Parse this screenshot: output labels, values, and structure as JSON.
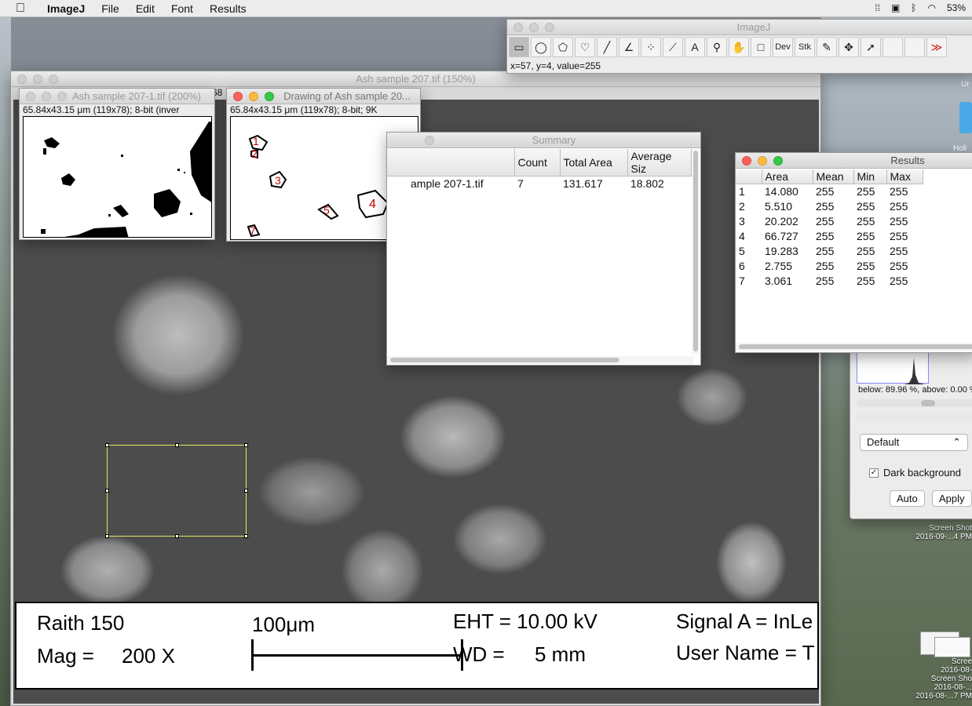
{
  "menubar": {
    "app": "ImageJ",
    "items": [
      "File",
      "Edit",
      "Font",
      "Results"
    ],
    "battery": "53%"
  },
  "toolbar_window": {
    "title": "ImageJ",
    "status": "x=57, y=4, value=255",
    "tools": [
      {
        "icon": "rectangle-icon",
        "glyph": "▭"
      },
      {
        "icon": "oval-icon",
        "glyph": "◯"
      },
      {
        "icon": "polygon-icon",
        "glyph": "⬠"
      },
      {
        "icon": "freehand-icon",
        "glyph": "♡"
      },
      {
        "icon": "line-icon",
        "glyph": "╱"
      },
      {
        "icon": "angle-icon",
        "glyph": "∠"
      },
      {
        "icon": "point-icon",
        "glyph": "⁘"
      },
      {
        "icon": "wand-icon",
        "glyph": "⟋"
      },
      {
        "icon": "text-icon",
        "glyph": "A"
      },
      {
        "icon": "magnifier-icon",
        "glyph": "⚲"
      },
      {
        "icon": "hand-icon",
        "glyph": "✋"
      },
      {
        "icon": "color-picker-icon",
        "glyph": "□"
      },
      {
        "icon": "developer-menu-icon",
        "glyph": "Dev"
      },
      {
        "icon": "stack-menu-icon",
        "glyph": "Stk"
      },
      {
        "icon": "brush-icon",
        "glyph": "✎"
      },
      {
        "icon": "flood-fill-icon",
        "glyph": "✥"
      },
      {
        "icon": "arrow-icon",
        "glyph": "➚"
      },
      {
        "icon": "empty-slot-icon",
        "glyph": ""
      },
      {
        "icon": "empty-slot-icon",
        "glyph": ""
      },
      {
        "icon": "more-tools-icon",
        "glyph": "≫"
      }
    ]
  },
  "main_window": {
    "title": "Ash sample 207.tif (150%)",
    "partial_header": "68",
    "infobar": {
      "instrument": "Raith 150",
      "mag_label": "Mag =",
      "mag_value": "200 X",
      "scale": "100μm",
      "eht": "EHT = 10.00 kV",
      "wd_label": "WD =",
      "wd_value": "5 mm",
      "signal": "Signal A = InLe",
      "user": "User Name = T"
    }
  },
  "binary_window": {
    "title": "Ash sample 207-1.tif (200%)",
    "info": "65.84x43.15 μm (119x78); 8-bit (inver"
  },
  "drawing_window": {
    "title": "Drawing of Ash sample 20...",
    "info": "65.84x43.15 μm (119x78); 8-bit; 9K",
    "labels": [
      "1",
      "2",
      "3",
      "4",
      "5",
      "6",
      "7"
    ]
  },
  "summary_window": {
    "title": "Summary",
    "columns": [
      "",
      "Count",
      "Total Area",
      "Average Siz"
    ],
    "rows": [
      [
        "ample 207-1.tif",
        "7",
        "131.617",
        "18.802"
      ]
    ]
  },
  "results_window": {
    "title": "Results",
    "columns": [
      "",
      "Area",
      "Mean",
      "Min",
      "Max"
    ],
    "rows": [
      [
        "1",
        "14.080",
        "255",
        "255",
        "255"
      ],
      [
        "2",
        "5.510",
        "255",
        "255",
        "255"
      ],
      [
        "3",
        "20.202",
        "255",
        "255",
        "255"
      ],
      [
        "4",
        "66.727",
        "255",
        "255",
        "255"
      ],
      [
        "5",
        "19.283",
        "255",
        "255",
        "255"
      ],
      [
        "6",
        "2.755",
        "255",
        "255",
        "255"
      ],
      [
        "7",
        "3.061",
        "255",
        "255",
        "255"
      ]
    ]
  },
  "threshold_panel": {
    "stats": "below: 89.96 %,  above: 0.00 %",
    "method": "Default",
    "dark_background_label": "Dark background",
    "dark_background_checked": true,
    "auto_label": "Auto",
    "apply_label": "Apply"
  },
  "desktop": {
    "partial_label_1": "Ur",
    "partial_label_2": "Holi",
    "file1_name": "Screen Shot",
    "file1_date": "2016-09-...4 PM",
    "file2_name": "Scree",
    "file2_date": "2016-08-",
    "file3_name": "Screen Sho",
    "file3_date": "2016-08-...",
    "file4_name": "2016-08-...7 PM"
  }
}
